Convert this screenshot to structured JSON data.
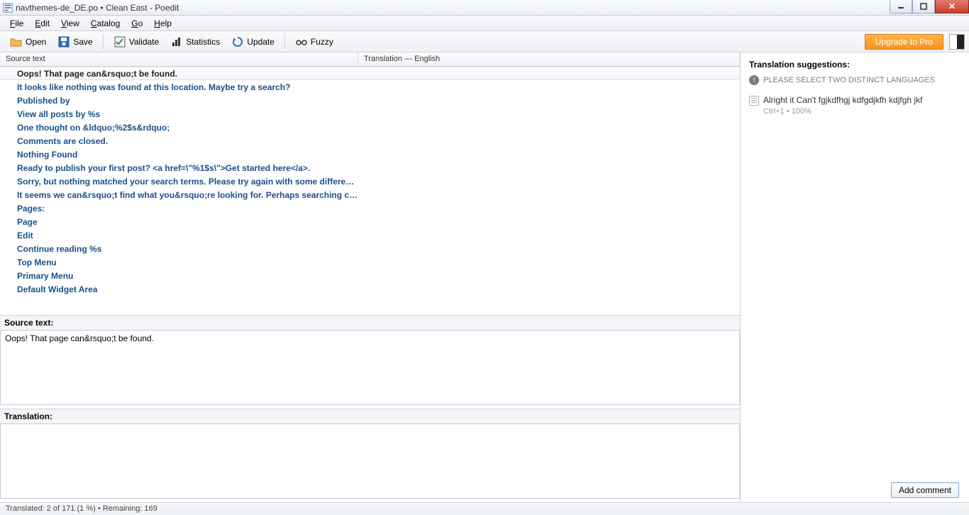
{
  "title": "navthemes-de_DE.po • Clean East - Poedit",
  "menus": {
    "file": "File",
    "edit": "Edit",
    "view": "View",
    "catalog": "Catalog",
    "go": "Go",
    "help": "Help"
  },
  "toolbar": {
    "open": "Open",
    "save": "Save",
    "validate": "Validate",
    "statistics": "Statistics",
    "update": "Update",
    "fuzzy": "Fuzzy",
    "upgrade": "Upgrade to Pro"
  },
  "grid": {
    "col_source": "Source text",
    "col_translation": "Translation — English",
    "rows": [
      "Oops! That page can&rsquo;t be found.",
      "It looks like nothing was found at this location. Maybe try a search?",
      "Published by",
      "View all posts by %s",
      "One thought on &ldquo;%2$s&rdquo;",
      "Comments are closed.",
      "Nothing Found",
      "Ready to publish your first post? <a href=\\\"%1$s\\\">Get started here</a>.",
      "Sorry, but nothing matched your search terms. Please try again with some different ...",
      "It seems we can&rsquo;t find what you&rsquo;re looking for. Perhaps searching can ...",
      "Pages:",
      "Page",
      "Edit",
      "Continue reading %s",
      "Top Menu",
      "Primary Menu",
      "Default Widget Area"
    ]
  },
  "editor": {
    "source_label": "Source text:",
    "source_value": "Oops! That page can&rsquo;t be found.",
    "translation_label": "Translation:",
    "translation_value": ""
  },
  "right": {
    "heading": "Translation suggestions:",
    "warning": "PLEASE SELECT TWO DISTINCT LANGUAGES",
    "suggestion_text": "Alright it Can't fgjkdfhgj kdfgdjkfh kdjfgh jkf",
    "suggestion_meta": "Ctrl+1 • 100%"
  },
  "add_comment": "Add comment",
  "status": "Translated: 2 of 171 (1 %)   •   Remaining: 169"
}
